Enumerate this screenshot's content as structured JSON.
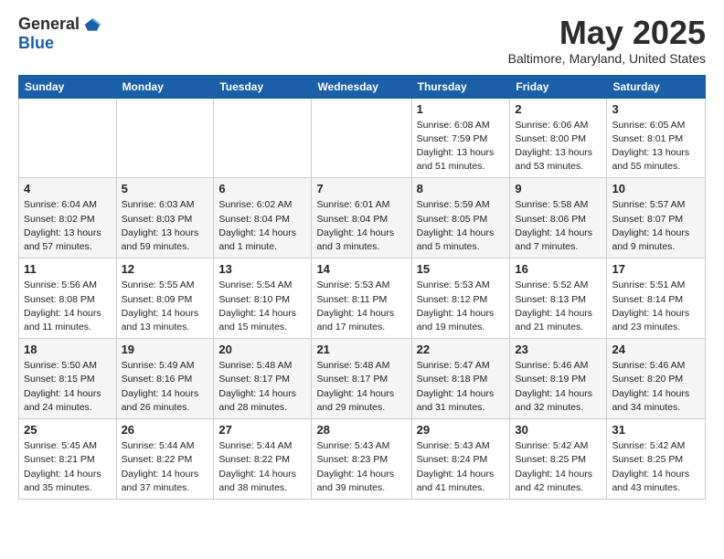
{
  "header": {
    "logo_general": "General",
    "logo_blue": "Blue",
    "main_title": "May 2025",
    "subtitle": "Baltimore, Maryland, United States"
  },
  "calendar": {
    "days_of_week": [
      "Sunday",
      "Monday",
      "Tuesday",
      "Wednesday",
      "Thursday",
      "Friday",
      "Saturday"
    ],
    "weeks": [
      [
        {
          "day": "",
          "info": ""
        },
        {
          "day": "",
          "info": ""
        },
        {
          "day": "",
          "info": ""
        },
        {
          "day": "",
          "info": ""
        },
        {
          "day": "1",
          "info": "Sunrise: 6:08 AM\nSunset: 7:59 PM\nDaylight: 13 hours\nand 51 minutes."
        },
        {
          "day": "2",
          "info": "Sunrise: 6:06 AM\nSunset: 8:00 PM\nDaylight: 13 hours\nand 53 minutes."
        },
        {
          "day": "3",
          "info": "Sunrise: 6:05 AM\nSunset: 8:01 PM\nDaylight: 13 hours\nand 55 minutes."
        }
      ],
      [
        {
          "day": "4",
          "info": "Sunrise: 6:04 AM\nSunset: 8:02 PM\nDaylight: 13 hours\nand 57 minutes."
        },
        {
          "day": "5",
          "info": "Sunrise: 6:03 AM\nSunset: 8:03 PM\nDaylight: 13 hours\nand 59 minutes."
        },
        {
          "day": "6",
          "info": "Sunrise: 6:02 AM\nSunset: 8:04 PM\nDaylight: 14 hours\nand 1 minute."
        },
        {
          "day": "7",
          "info": "Sunrise: 6:01 AM\nSunset: 8:04 PM\nDaylight: 14 hours\nand 3 minutes."
        },
        {
          "day": "8",
          "info": "Sunrise: 5:59 AM\nSunset: 8:05 PM\nDaylight: 14 hours\nand 5 minutes."
        },
        {
          "day": "9",
          "info": "Sunrise: 5:58 AM\nSunset: 8:06 PM\nDaylight: 14 hours\nand 7 minutes."
        },
        {
          "day": "10",
          "info": "Sunrise: 5:57 AM\nSunset: 8:07 PM\nDaylight: 14 hours\nand 9 minutes."
        }
      ],
      [
        {
          "day": "11",
          "info": "Sunrise: 5:56 AM\nSunset: 8:08 PM\nDaylight: 14 hours\nand 11 minutes."
        },
        {
          "day": "12",
          "info": "Sunrise: 5:55 AM\nSunset: 8:09 PM\nDaylight: 14 hours\nand 13 minutes."
        },
        {
          "day": "13",
          "info": "Sunrise: 5:54 AM\nSunset: 8:10 PM\nDaylight: 14 hours\nand 15 minutes."
        },
        {
          "day": "14",
          "info": "Sunrise: 5:53 AM\nSunset: 8:11 PM\nDaylight: 14 hours\nand 17 minutes."
        },
        {
          "day": "15",
          "info": "Sunrise: 5:53 AM\nSunset: 8:12 PM\nDaylight: 14 hours\nand 19 minutes."
        },
        {
          "day": "16",
          "info": "Sunrise: 5:52 AM\nSunset: 8:13 PM\nDaylight: 14 hours\nand 21 minutes."
        },
        {
          "day": "17",
          "info": "Sunrise: 5:51 AM\nSunset: 8:14 PM\nDaylight: 14 hours\nand 23 minutes."
        }
      ],
      [
        {
          "day": "18",
          "info": "Sunrise: 5:50 AM\nSunset: 8:15 PM\nDaylight: 14 hours\nand 24 minutes."
        },
        {
          "day": "19",
          "info": "Sunrise: 5:49 AM\nSunset: 8:16 PM\nDaylight: 14 hours\nand 26 minutes."
        },
        {
          "day": "20",
          "info": "Sunrise: 5:48 AM\nSunset: 8:17 PM\nDaylight: 14 hours\nand 28 minutes."
        },
        {
          "day": "21",
          "info": "Sunrise: 5:48 AM\nSunset: 8:17 PM\nDaylight: 14 hours\nand 29 minutes."
        },
        {
          "day": "22",
          "info": "Sunrise: 5:47 AM\nSunset: 8:18 PM\nDaylight: 14 hours\nand 31 minutes."
        },
        {
          "day": "23",
          "info": "Sunrise: 5:46 AM\nSunset: 8:19 PM\nDaylight: 14 hours\nand 32 minutes."
        },
        {
          "day": "24",
          "info": "Sunrise: 5:46 AM\nSunset: 8:20 PM\nDaylight: 14 hours\nand 34 minutes."
        }
      ],
      [
        {
          "day": "25",
          "info": "Sunrise: 5:45 AM\nSunset: 8:21 PM\nDaylight: 14 hours\nand 35 minutes."
        },
        {
          "day": "26",
          "info": "Sunrise: 5:44 AM\nSunset: 8:22 PM\nDaylight: 14 hours\nand 37 minutes."
        },
        {
          "day": "27",
          "info": "Sunrise: 5:44 AM\nSunset: 8:22 PM\nDaylight: 14 hours\nand 38 minutes."
        },
        {
          "day": "28",
          "info": "Sunrise: 5:43 AM\nSunset: 8:23 PM\nDaylight: 14 hours\nand 39 minutes."
        },
        {
          "day": "29",
          "info": "Sunrise: 5:43 AM\nSunset: 8:24 PM\nDaylight: 14 hours\nand 41 minutes."
        },
        {
          "day": "30",
          "info": "Sunrise: 5:42 AM\nSunset: 8:25 PM\nDaylight: 14 hours\nand 42 minutes."
        },
        {
          "day": "31",
          "info": "Sunrise: 5:42 AM\nSunset: 8:25 PM\nDaylight: 14 hours\nand 43 minutes."
        }
      ]
    ]
  }
}
